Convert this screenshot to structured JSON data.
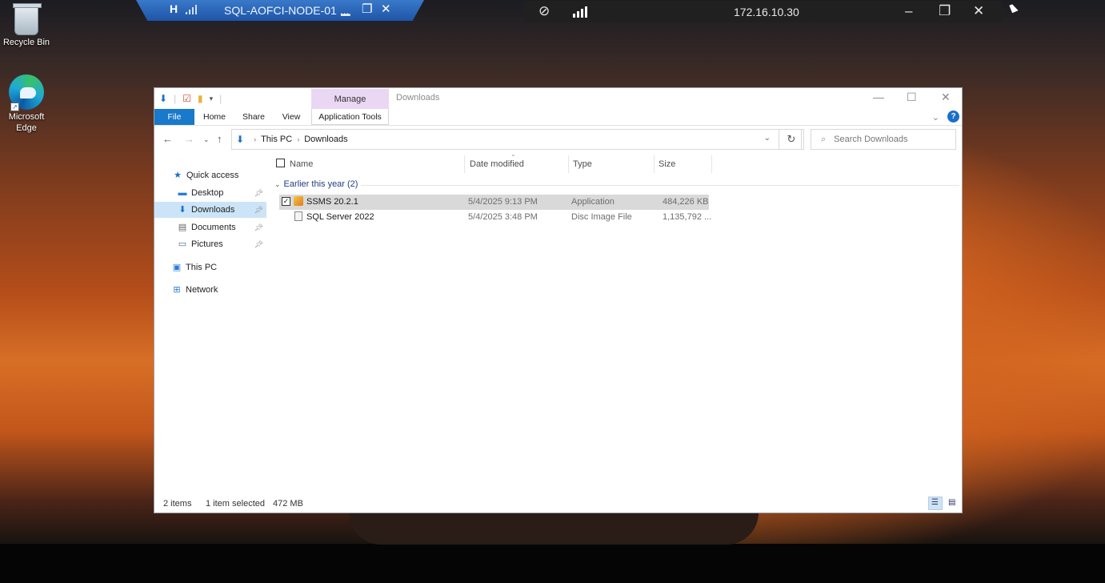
{
  "desktop": {
    "icons": [
      {
        "label": "Recycle Bin"
      },
      {
        "label": "Microsoft Edge"
      }
    ]
  },
  "rdp_bar": {
    "title": "SQL-AOFCI-NODE-01 ...",
    "pin_glyph": "H"
  },
  "remote_toolbar": {
    "ip": "172.16.10.30"
  },
  "explorer": {
    "ribbon": {
      "manage_tab": "Manage",
      "window_title": "Downloads",
      "tabs": [
        "File",
        "Home",
        "Share",
        "View",
        "Application Tools"
      ]
    },
    "address": {
      "crumbs": [
        "This PC",
        "Downloads"
      ]
    },
    "search_placeholder": "Search Downloads",
    "sidebar": {
      "items": [
        {
          "label": "Quick access",
          "icon": "star-icon"
        },
        {
          "label": "Desktop",
          "icon": "desktop-icon"
        },
        {
          "label": "Downloads",
          "icon": "download-arrow-icon"
        },
        {
          "label": "Documents",
          "icon": "documents-icon"
        },
        {
          "label": "Pictures",
          "icon": "pictures-icon"
        },
        {
          "label": "This PC",
          "icon": "computer-icon"
        },
        {
          "label": "Network",
          "icon": "network-icon"
        }
      ]
    },
    "columns": [
      "Name",
      "Date modified",
      "Type",
      "Size"
    ],
    "group": "Earlier this year (2)",
    "files": [
      {
        "name": "SSMS 20.2.1",
        "date": "5/4/2025 9:13 PM",
        "type": "Application",
        "size": "484,226 KB",
        "selected": true
      },
      {
        "name": "SQL Server 2022",
        "date": "5/4/2025 3:48 PM",
        "type": "Disc Image File",
        "size": "1,135,792 ...",
        "selected": false
      }
    ],
    "status": {
      "items": "2 items",
      "selected": "1 item selected",
      "size": "472 MB"
    }
  },
  "colors": {
    "file_tab": "#1979ca",
    "manage_tab": "#ead7f3",
    "selection": "#cce4f7",
    "group_text": "#1e3f82"
  }
}
